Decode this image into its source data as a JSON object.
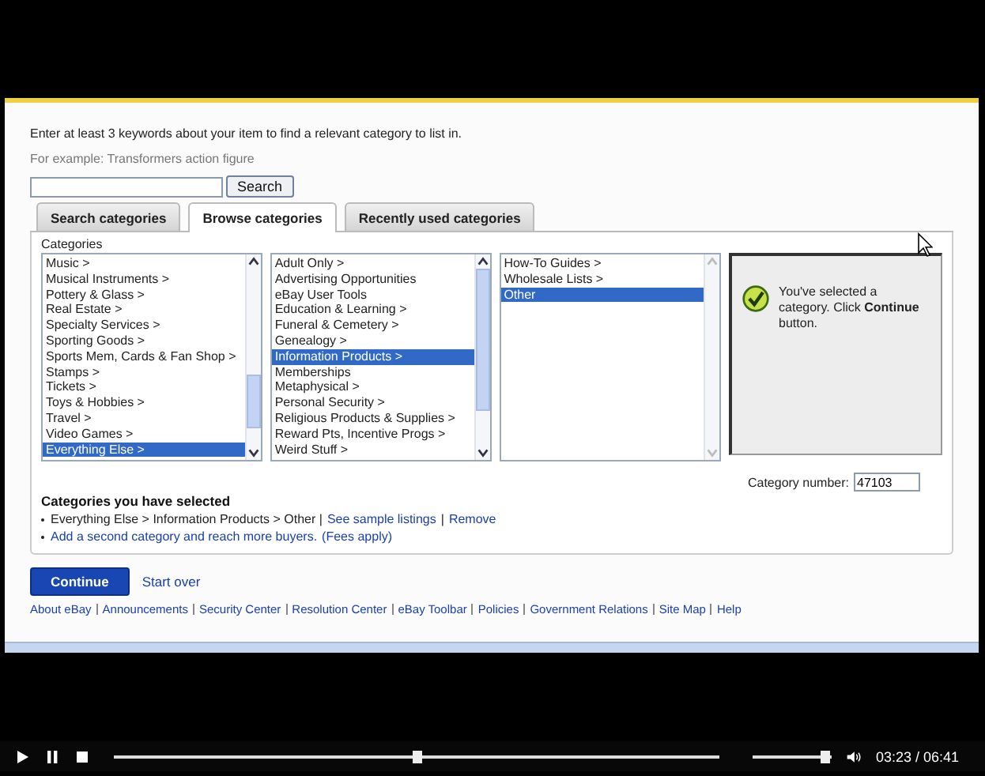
{
  "instructions": "Enter at least 3 keywords about your item to find a relevant category to list in.",
  "example": "For example: Transformers action figure",
  "search": {
    "button": "Search"
  },
  "tabs": [
    {
      "label": "Search categories",
      "selected": false
    },
    {
      "label": "Browse categories",
      "selected": true
    },
    {
      "label": "Recently used categories",
      "selected": false
    }
  ],
  "categories_label": "Categories",
  "columns": [
    {
      "items": [
        {
          "label": "Music >",
          "selected": false
        },
        {
          "label": "Musical Instruments >",
          "selected": false
        },
        {
          "label": "Pottery & Glass >",
          "selected": false
        },
        {
          "label": "Real Estate >",
          "selected": false
        },
        {
          "label": "Specialty Services >",
          "selected": false
        },
        {
          "label": "Sporting Goods >",
          "selected": false
        },
        {
          "label": "Sports Mem, Cards & Fan Shop >",
          "selected": false
        },
        {
          "label": "Stamps >",
          "selected": false
        },
        {
          "label": "Tickets >",
          "selected": false
        },
        {
          "label": "Toys & Hobbies >",
          "selected": false
        },
        {
          "label": "Travel >",
          "selected": false
        },
        {
          "label": "Video Games >",
          "selected": false
        },
        {
          "label": "Everything Else >",
          "selected": true
        }
      ]
    },
    {
      "items": [
        {
          "label": "Adult Only >",
          "selected": false
        },
        {
          "label": "Advertising Opportunities",
          "selected": false
        },
        {
          "label": "eBay User Tools",
          "selected": false
        },
        {
          "label": "Education & Learning >",
          "selected": false
        },
        {
          "label": "Funeral & Cemetery >",
          "selected": false
        },
        {
          "label": "Genealogy >",
          "selected": false
        },
        {
          "label": "Information Products >",
          "selected": true
        },
        {
          "label": "Memberships",
          "selected": false
        },
        {
          "label": "Metaphysical >",
          "selected": false
        },
        {
          "label": "Personal Security >",
          "selected": false
        },
        {
          "label": "Religious Products & Supplies >",
          "selected": false
        },
        {
          "label": "Reward Pts, Incentive Progs >",
          "selected": false
        },
        {
          "label": "Weird Stuff >",
          "selected": false
        }
      ]
    },
    {
      "items": [
        {
          "label": "How-To Guides >",
          "selected": false
        },
        {
          "label": "Wholesale Lists >",
          "selected": false
        },
        {
          "label": "Other",
          "selected": true
        }
      ]
    }
  ],
  "confirmation": "You've selected a category. Click **Continue** button.",
  "category_number": {
    "label": "Category number:",
    "value": "47103"
  },
  "selected_heading": "Categories you have selected",
  "selected_lines": [
    [
      {
        "kind": "text",
        "text": "Everything Else > Information Products > Other |"
      },
      {
        "kind": "link",
        "text": "See sample listings"
      },
      {
        "kind": "text",
        "text": "|"
      },
      {
        "kind": "link",
        "text": "Remove"
      }
    ],
    [
      {
        "kind": "link",
        "text": "Add a second category and reach more buyers."
      },
      {
        "kind": "link",
        "text": "(Fees apply)"
      }
    ]
  ],
  "continue_button": "Continue",
  "start_over": "Start over",
  "footer_links": [
    "About eBay",
    "Announcements",
    "Security Center",
    "Resolution Center",
    "eBay Toolbar",
    "Policies",
    "Government Relations",
    "Site Map",
    "Help"
  ],
  "player": {
    "progress": {
      "level": 0.51
    },
    "volume": {
      "level": 0.97
    },
    "time": "03:23 / 06:41"
  }
}
